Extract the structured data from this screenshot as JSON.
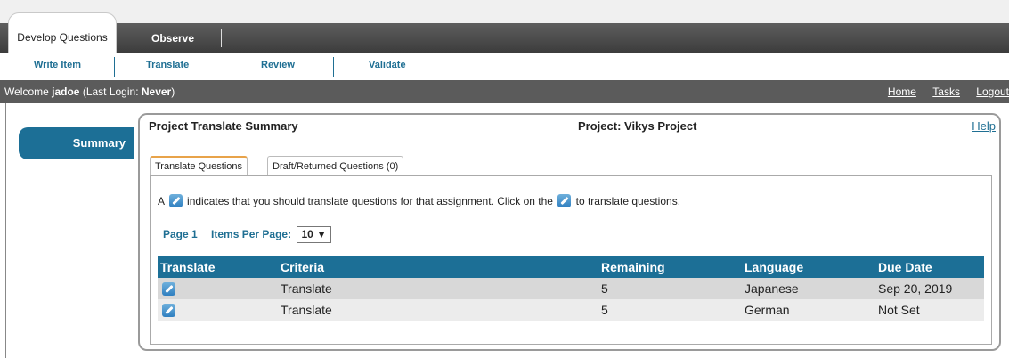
{
  "top_tabs": [
    {
      "label": "Develop Questions",
      "active": true
    },
    {
      "label": "Observe",
      "active": false
    }
  ],
  "sub_nav": [
    {
      "label": "Write Item",
      "active": false
    },
    {
      "label": "Translate",
      "active": true
    },
    {
      "label": "Review",
      "active": false
    },
    {
      "label": "Validate",
      "active": false
    }
  ],
  "welcome": {
    "prefix": "Welcome ",
    "user": "jadoe",
    "middle": " (Last Login: ",
    "last_login": "Never",
    "suffix": ")",
    "links": [
      "Home",
      "Tasks",
      "Logout"
    ]
  },
  "sidebar": {
    "summary_label": "Summary"
  },
  "panel": {
    "title": "Project Translate Summary",
    "project": "Project: Vikys Project",
    "help": "Help",
    "tabs": [
      {
        "label": "Translate Questions",
        "active": true
      },
      {
        "label": "Draft/Returned Questions (0)",
        "active": false
      }
    ],
    "instruction_a": "A",
    "instruction_b": "indicates that you should translate questions for that assignment. Click on the",
    "instruction_c": "to translate questions.",
    "page_label": "Page 1",
    "items_per_page_label": "Items Per Page:",
    "items_per_page_value": "10 ▼"
  },
  "table": {
    "headers": [
      "Translate",
      "Criteria",
      "Remaining",
      "Language",
      "Due Date"
    ],
    "rows": [
      {
        "criteria": "Translate",
        "remaining": "5",
        "language": "Japanese",
        "due": "Sep 20, 2019"
      },
      {
        "criteria": "Translate",
        "remaining": "5",
        "language": "German",
        "due": "Not Set"
      }
    ]
  },
  "icons": {
    "translate": "pencil-edit-icon"
  },
  "colors": {
    "accent": "#1c6f96",
    "header_bg": "#3b3b3b",
    "welcome_bg": "#5b5b5b",
    "row_alt1": "#d8d8d8",
    "row_alt2": "#ececec"
  }
}
